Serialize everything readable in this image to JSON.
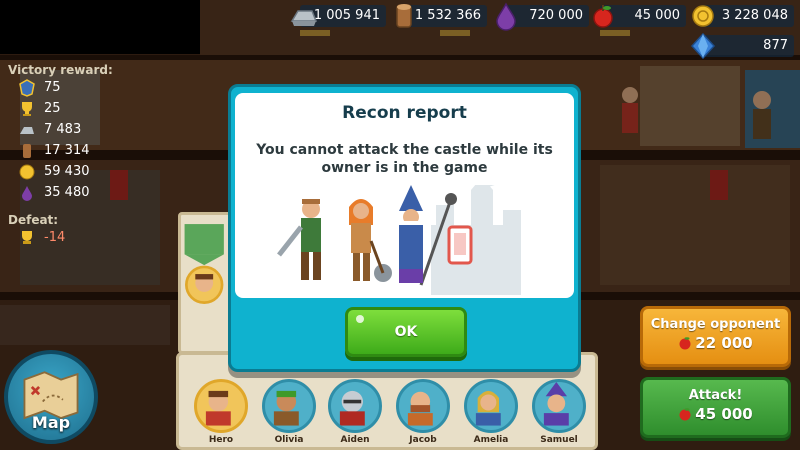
{
  "resources": {
    "iron": "1 005 941",
    "wood": "1 532 366",
    "potion": "720 000",
    "food": "45 000",
    "gold": "3 228 048",
    "gems": "877"
  },
  "reward_panel": {
    "title": "Victory reward:",
    "trophies": "75",
    "stars": "25",
    "iron": "7 483",
    "wood": "17 314",
    "gold": "59 430",
    "potion": "35 480",
    "defeat_title": "Defeat:",
    "defeat_trophies": "-14"
  },
  "dialog": {
    "title": "Recon report",
    "message": "You cannot attack the castle while its owner is in the game",
    "ok_label": "OK"
  },
  "buttons": {
    "change_opponent_label": "Change opponent",
    "change_opponent_cost": "22 000",
    "attack_label": "Attack!",
    "attack_cost": "45 000",
    "map_label": "Map"
  },
  "heroes": [
    {
      "name": "Hero"
    },
    {
      "name": "Olivia"
    },
    {
      "name": "Aiden"
    },
    {
      "name": "Jacob"
    },
    {
      "name": "Amelia"
    },
    {
      "name": "Samuel"
    }
  ],
  "behind_panel_label": "Hero",
  "colors": {
    "dialog_frame": "#0fb2cf",
    "ok_button": "#4fbf22",
    "change_button": "#f0a322",
    "attack_button": "#3ea33a"
  }
}
